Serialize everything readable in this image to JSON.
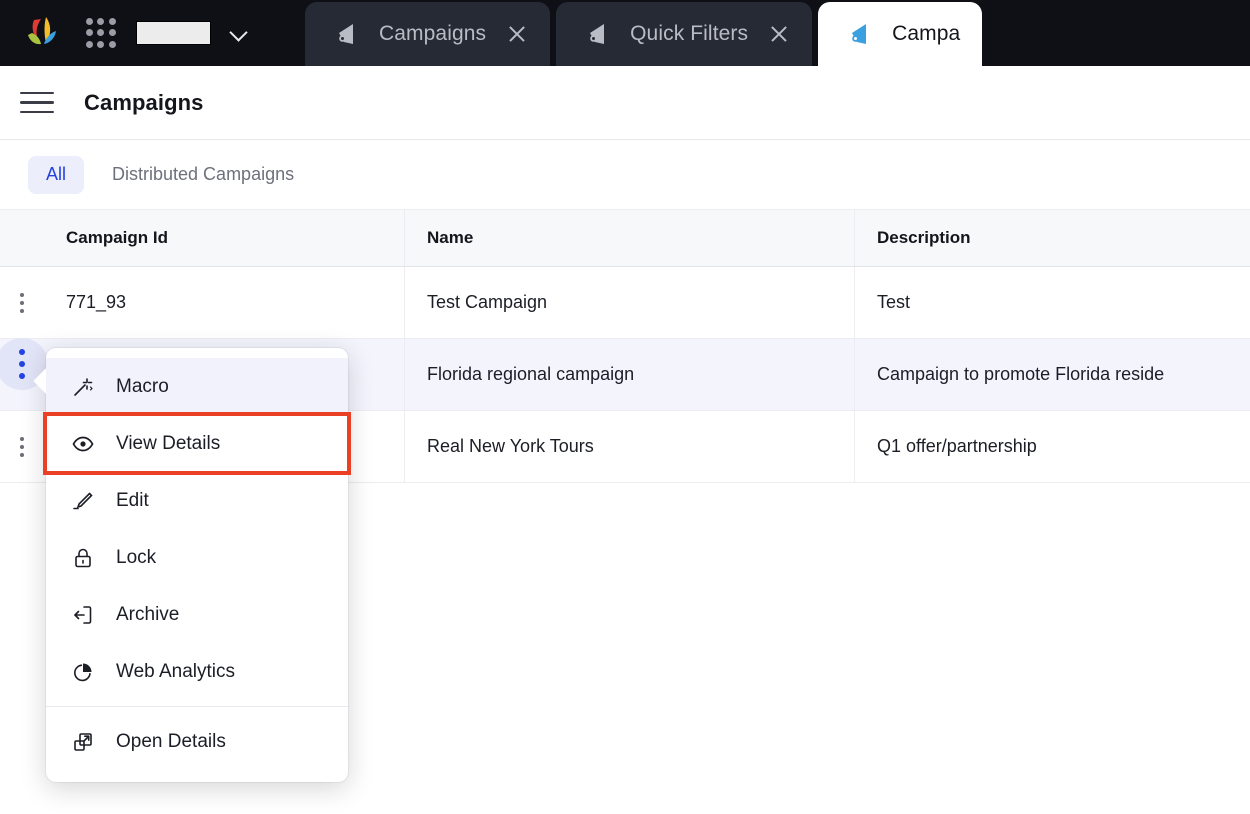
{
  "browser": {
    "org_selector": {
      "value": "",
      "icon": "chevron-down-icon"
    },
    "apps_icon": "apps-grid-icon",
    "logo": "zoho-logo-icon",
    "tabs": [
      {
        "label": "Campaigns",
        "icon": "megaphone-icon",
        "active": false,
        "close": "close-icon"
      },
      {
        "label": "Quick Filters",
        "icon": "megaphone-icon",
        "active": false,
        "close": "close-icon"
      },
      {
        "label": "Campa",
        "icon": "megaphone-icon",
        "active": true,
        "close": "close-icon"
      }
    ]
  },
  "header": {
    "menu_icon": "hamburger-menu-icon",
    "title": "Campaigns"
  },
  "filters": {
    "tabs": [
      {
        "label": "All",
        "selected": true
      },
      {
        "label": "Distributed Campaigns",
        "selected": false
      }
    ]
  },
  "table": {
    "columns": [
      "Campaign Id",
      "Name",
      "Description"
    ],
    "rows": [
      {
        "id": "771_93",
        "name": "Test Campaign",
        "description": "Test"
      },
      {
        "id": "",
        "name": "Florida regional campaign",
        "description": "Campaign to promote Florida reside"
      },
      {
        "id": "",
        "name": "Real New York Tours",
        "description": "Q1 offer/partnership"
      }
    ]
  },
  "context_menu": {
    "items": [
      {
        "label": "Macro",
        "icon": "magic-wand-icon",
        "state": "hovered"
      },
      {
        "label": "View Details",
        "icon": "eye-icon",
        "state": "focused"
      },
      {
        "label": "Edit",
        "icon": "pencil-icon",
        "state": ""
      },
      {
        "label": "Lock",
        "icon": "lock-icon",
        "state": ""
      },
      {
        "label": "Archive",
        "icon": "archive-icon",
        "state": ""
      },
      {
        "label": "Web Analytics",
        "icon": "pie-chart-icon",
        "state": ""
      },
      {
        "label": "Open Details",
        "icon": "open-in-new-icon",
        "state": ""
      }
    ]
  },
  "colors": {
    "accent_blue": "#2342e0",
    "highlight_red": "#ea4026",
    "tab_bar_bg": "#0e1016",
    "tab_bg": "#262a35"
  }
}
